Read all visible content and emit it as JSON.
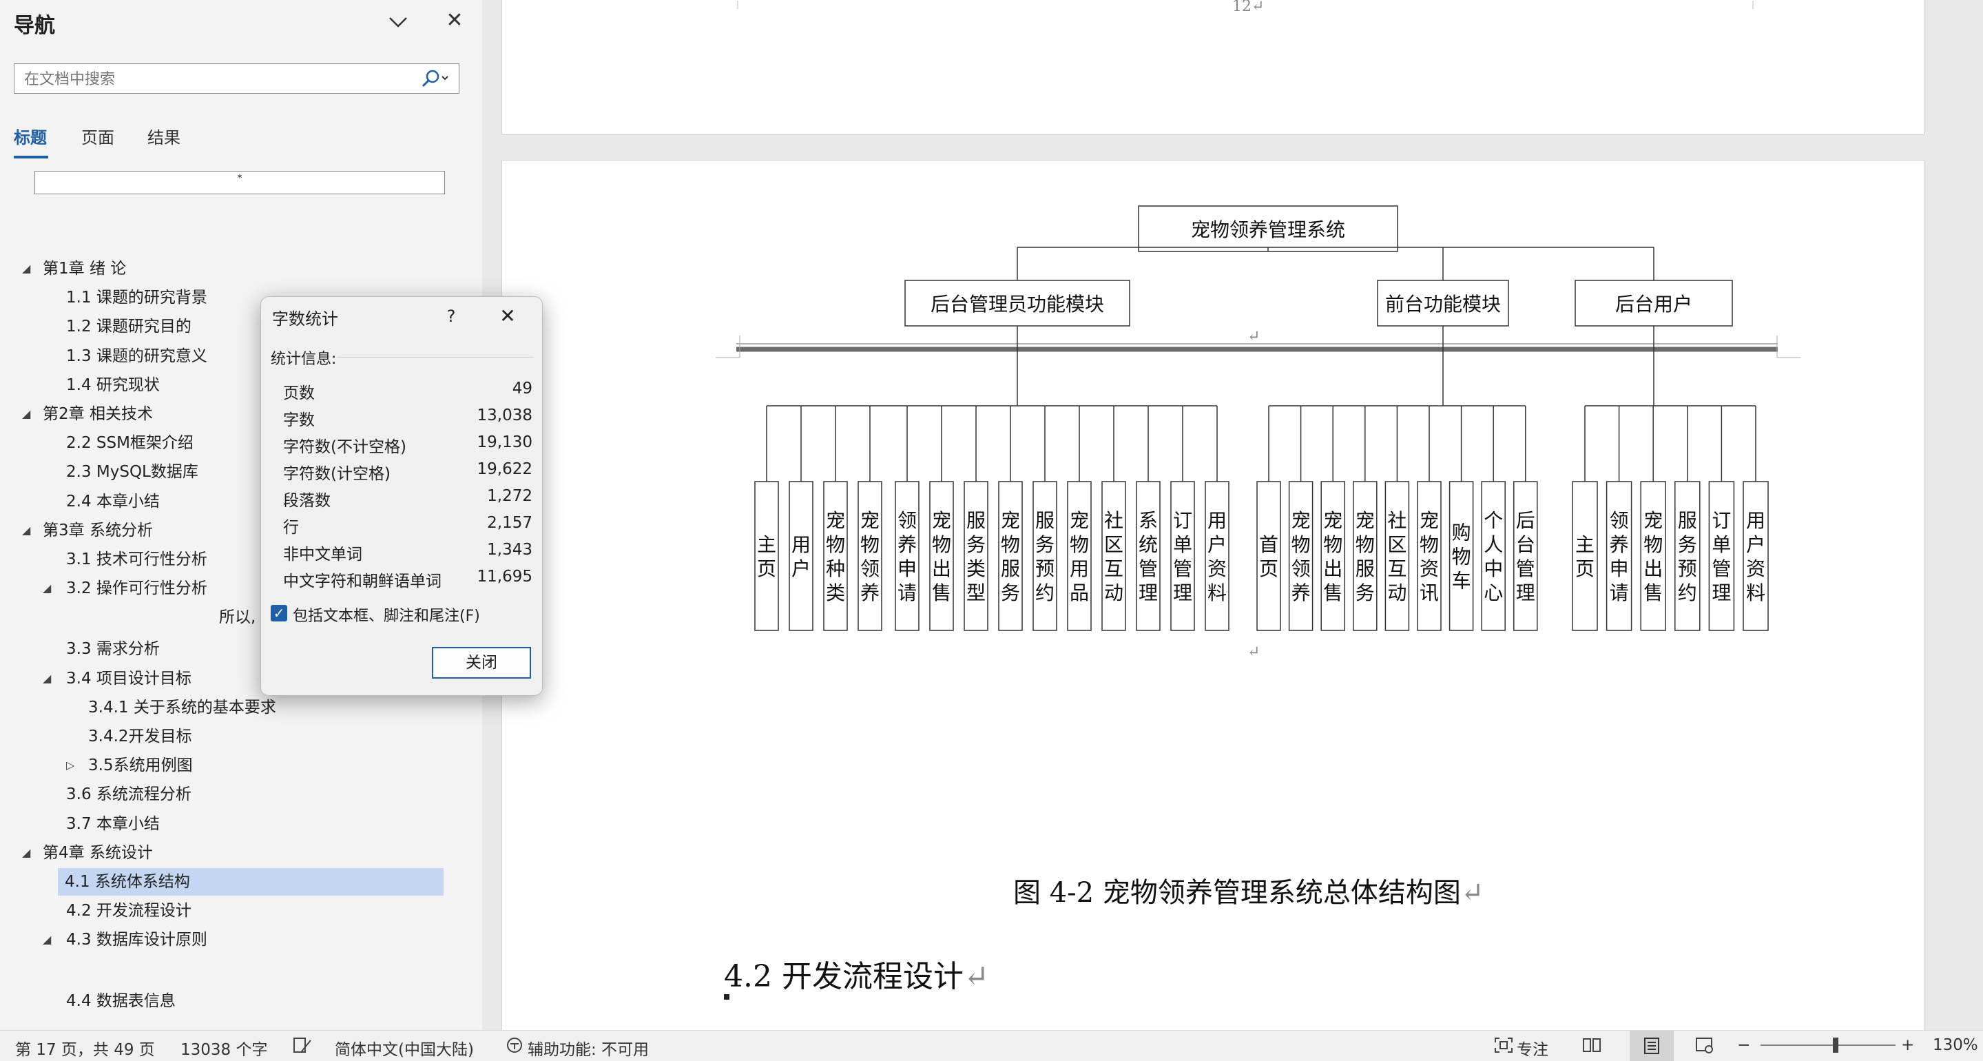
{
  "nav": {
    "title": "导航",
    "search_placeholder": "在文档中搜索",
    "tabs": [
      "标题",
      "页面",
      "结果"
    ],
    "mini_box_text": "*",
    "items": [
      {
        "label": "第1章    绪 论",
        "level": 0,
        "expand": "expanded"
      },
      {
        "label": "1.1 课题的研究背景",
        "level": 1,
        "expand": "none"
      },
      {
        "label": "1.2 课题研究目的",
        "level": 1,
        "expand": "none"
      },
      {
        "label": "1.3 课题的研究意义",
        "level": 1,
        "expand": "none"
      },
      {
        "label": "1.4 研究现状",
        "level": 1,
        "expand": "none"
      },
      {
        "label": "第2章   相关技术",
        "level": 0,
        "expand": "expanded"
      },
      {
        "label": "2.2  SSM框架介绍",
        "level": 1,
        "expand": "none"
      },
      {
        "label": "2.3 MySQL数据库",
        "level": 1,
        "expand": "none"
      },
      {
        "label": "2.4 本章小结",
        "level": 1,
        "expand": "none"
      },
      {
        "label": "第3章  系统分析",
        "level": 0,
        "expand": "expanded"
      },
      {
        "label": "3.1 技术可行性分析",
        "level": 1,
        "expand": "none"
      },
      {
        "label": "3.2  操作可行性分析",
        "level": 1,
        "expand": "expanded"
      },
      {
        "label": "所以,",
        "level": 3,
        "expand": "none"
      },
      {
        "label": "3.3 需求分析",
        "level": 1,
        "expand": "none"
      },
      {
        "label": "3.4 项目设计目标",
        "level": 1,
        "expand": "expanded"
      },
      {
        "label": "3.4.1 关于系统的基本要求",
        "level": 2,
        "expand": "none"
      },
      {
        "label": "3.4.2开发目标",
        "level": 2,
        "expand": "none"
      },
      {
        "label": "3.5系统用例图",
        "level": 2,
        "expand": "collapsed"
      },
      {
        "label": "3.6 系统流程分析",
        "level": 1,
        "expand": "none"
      },
      {
        "label": "3.7  本章小结",
        "level": 1,
        "expand": "none"
      },
      {
        "label": "第4章  系统设计",
        "level": 0,
        "expand": "expanded"
      },
      {
        "label": "4.1 系统体系结构",
        "level": 1,
        "expand": "none",
        "selected": true
      },
      {
        "label": "4.2  开发流程设计",
        "level": 1,
        "expand": "none"
      },
      {
        "label": "4.3  数据库设计原则",
        "level": 1,
        "expand": "expanded"
      },
      {
        "label": "",
        "level": 1,
        "expand": "none"
      },
      {
        "label": "4.4  数据表信息",
        "level": 1,
        "expand": "none"
      }
    ]
  },
  "document": {
    "page_number": "12",
    "para_mark": "↵",
    "figure_caption": "图 4-2  宠物领养管理系统总体结构图",
    "section_heading": "4.2   开发流程设计",
    "org_chart": {
      "root": "宠物领养管理系统",
      "modules": [
        {
          "name": "后台管理员功能模块",
          "children": [
            "主页",
            "用户",
            "宠物种类",
            "宠物领养",
            "领养申请",
            "宠物出售",
            "服务类型",
            "宠物服务",
            "服务预约",
            "宠物用品",
            "社区互动",
            "系统管理",
            "订单管理",
            "用户资料"
          ]
        },
        {
          "name": "前台功能模块",
          "children": [
            "首页",
            "宠物领养",
            "宠物出售",
            "宠物服务",
            "社区互动",
            "宠物资讯",
            "购物车",
            "个人中心",
            "后台管理"
          ]
        },
        {
          "name": "后台用户",
          "children": [
            "主页",
            "领养申请",
            "宠物出售",
            "服务预约",
            "订单管理",
            "用户资料"
          ]
        }
      ]
    }
  },
  "dialog": {
    "title": "字数统计",
    "help": "?",
    "section_label": "统计信息:",
    "stats": [
      {
        "label": "页数",
        "value": "49"
      },
      {
        "label": "字数",
        "value": "13,038"
      },
      {
        "label": "字符数(不计空格)",
        "value": "19,130"
      },
      {
        "label": "字符数(计空格)",
        "value": "19,622"
      },
      {
        "label": "段落数",
        "value": "1,272"
      },
      {
        "label": "行",
        "value": "2,157"
      },
      {
        "label": "非中文单词",
        "value": "1,343"
      },
      {
        "label": "中文字符和朝鲜语单词",
        "value": "11,695"
      }
    ],
    "checkbox_label": "包括文本框、脚注和尾注(F)",
    "checkbox_checked": true,
    "close_label": "关闭"
  },
  "statusbar": {
    "page_info": "第 17 页，共 49 页",
    "word_count": "13038 个字",
    "language": "简体中文(中国大陆)",
    "accessibility": "辅助功能: 不可用",
    "focus": "专注",
    "zoom_minus": "−",
    "zoom_plus": "+",
    "zoom": "130%",
    "zoom_level": 130
  },
  "colors": {
    "accent": "#1f5fa8",
    "selected_bg": "#c3d7f2"
  }
}
